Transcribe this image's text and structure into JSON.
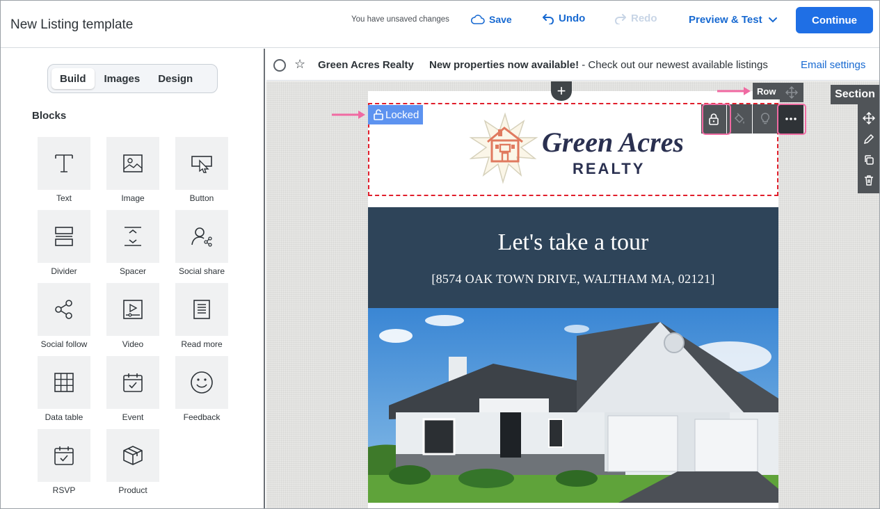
{
  "topbar": {
    "title": "New Listing template",
    "unsaved": "You have unsaved changes",
    "save": "Save",
    "undo": "Undo",
    "redo": "Redo",
    "preview": "Preview & Test",
    "continue": "Continue",
    "accent": "#1f6fe5"
  },
  "panel": {
    "tabs": [
      {
        "label": "Build",
        "active": true
      },
      {
        "label": "Images",
        "active": false
      },
      {
        "label": "Design",
        "active": false
      }
    ],
    "heading": "Blocks",
    "blocks": [
      {
        "label": "Text",
        "icon": "text-icon"
      },
      {
        "label": "Image",
        "icon": "image-icon"
      },
      {
        "label": "Button",
        "icon": "button-icon"
      },
      {
        "label": "Divider",
        "icon": "divider-icon"
      },
      {
        "label": "Spacer",
        "icon": "spacer-icon"
      },
      {
        "label": "Social share",
        "icon": "social-share-icon"
      },
      {
        "label": "Social follow",
        "icon": "social-follow-icon"
      },
      {
        "label": "Video",
        "icon": "video-icon"
      },
      {
        "label": "Read more",
        "icon": "read-more-icon"
      },
      {
        "label": "Data table",
        "icon": "data-table-icon"
      },
      {
        "label": "Event",
        "icon": "event-icon"
      },
      {
        "label": "Feedback",
        "icon": "feedback-icon"
      },
      {
        "label": "RSVP",
        "icon": "rsvp-icon"
      },
      {
        "label": "Product",
        "icon": "product-icon"
      }
    ]
  },
  "preview": {
    "sender": "Green Acres Realty",
    "subject_bold": "New properties now available!",
    "subject_rest": " - Check out our newest available listings",
    "email_settings": "Email settings"
  },
  "email": {
    "locked": "Locked",
    "row_label": "Row",
    "section_label": "Section",
    "logo_line1": "Green Acres",
    "logo_line2": "REALTY",
    "hero_title": "Let's take a tour",
    "hero_address": "[8574 OAK TOWN DRIVE, WALTHAM MA, 02121]",
    "hero_color": "#2e4459",
    "lock_border_color": "#e01e2b",
    "highlight_color": "#f06aa2"
  }
}
